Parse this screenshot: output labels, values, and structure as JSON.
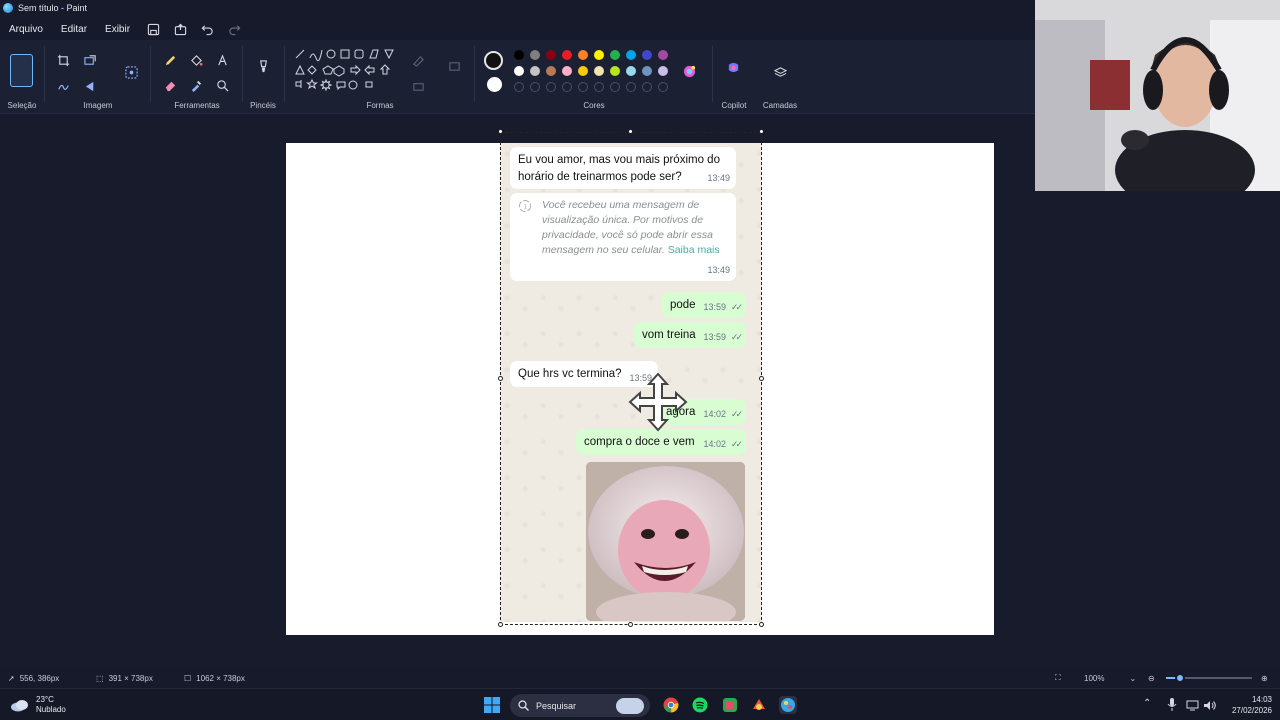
{
  "window": {
    "title": "Sem título - Paint"
  },
  "menu": {
    "items": [
      "Arquivo",
      "Editar",
      "Exibir"
    ]
  },
  "ribbon": {
    "groups": {
      "selecao": "Seleção",
      "imagem": "Imagem",
      "ferramentas": "Ferramentas",
      "pinceis": "Pincéis",
      "formas": "Formas",
      "cores": "Cores",
      "copilot": "Copilot",
      "camadas": "Camadas"
    },
    "colors": {
      "current_primary": "#111111",
      "current_secondary": "#ffffff",
      "row1": [
        "#000000",
        "#7f7f7f",
        "#880015",
        "#ed1c24",
        "#ff7f27",
        "#fff200",
        "#22b14c",
        "#00a2e8",
        "#3f48cc",
        "#a349a4"
      ],
      "row2": [
        "#ffffff",
        "#c3c3c3",
        "#b97a57",
        "#ffaec9",
        "#ffc90e",
        "#efe4b0",
        "#b5e61d",
        "#99d9ea",
        "#7092be",
        "#c8bfe7"
      ]
    }
  },
  "chat": {
    "messages": [
      {
        "dir": "in",
        "text1": "Eu vou amor, mas vou mais próximo do",
        "text2": "horário de treinarmos pode ser?",
        "time": "13:49"
      },
      {
        "dir": "in",
        "notice1": "Você recebeu uma mensagem de",
        "notice2": "visualização única. Por motivos de",
        "notice3": "privacidade, você só pode abrir essa",
        "notice4": "mensagem no seu celular.",
        "link": "Saiba mais",
        "time": "13:49"
      },
      {
        "dir": "out",
        "text": "pode",
        "time": "13:59"
      },
      {
        "dir": "out",
        "text": "vom treina",
        "time": "13:59"
      },
      {
        "dir": "in",
        "text": "Que hrs vc termina?",
        "time": "13:59"
      },
      {
        "dir": "out",
        "text": "agora",
        "time": "14:02"
      },
      {
        "dir": "out",
        "text": "compra o doce e vem",
        "time": "14:02"
      }
    ]
  },
  "status": {
    "cursor": "556, 386px",
    "selection": "391 × 738px",
    "canvas": "1062 × 738px",
    "zoom": "100%"
  },
  "taskbar": {
    "temp": "23°C",
    "weather": "Nublado",
    "search": "Pesquisar",
    "time": "14:03",
    "date": "27/02/2026"
  }
}
